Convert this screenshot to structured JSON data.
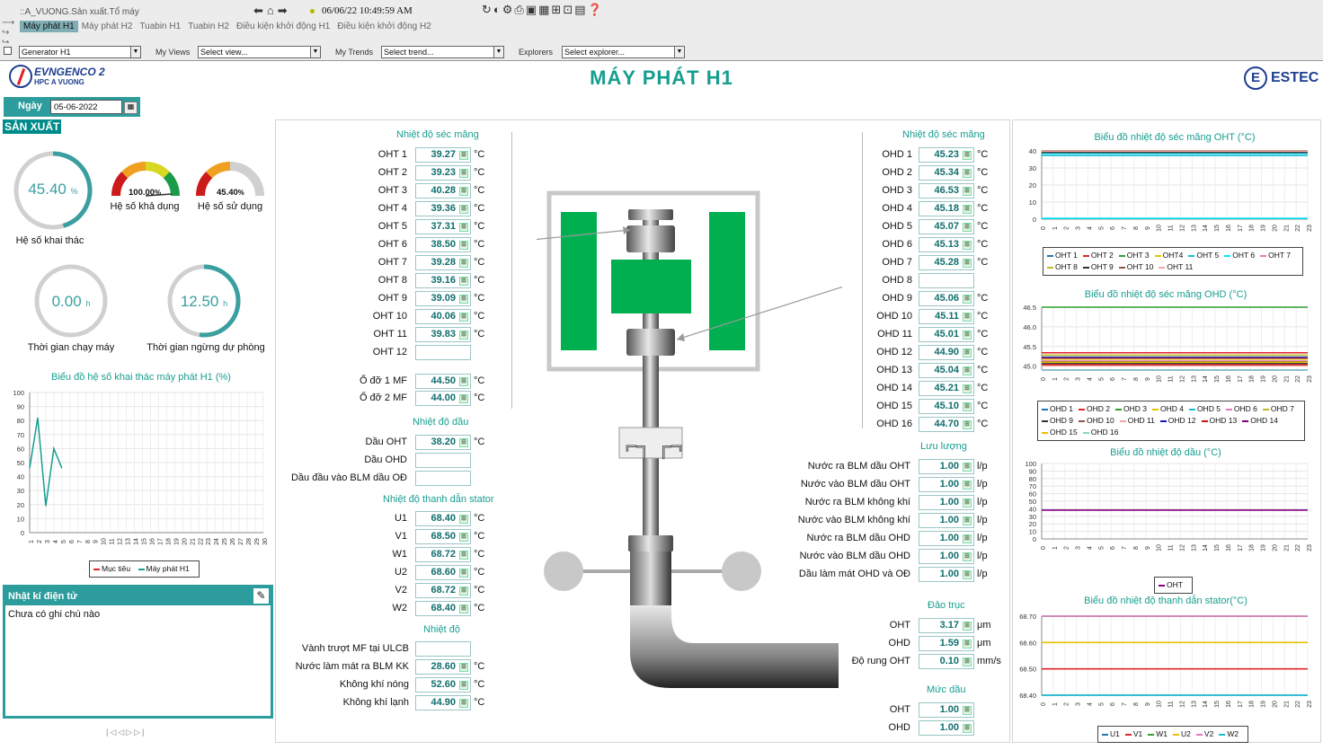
{
  "topbar": {
    "path": "::A_VUONG.Sản xuất.Tổ máy",
    "datetime": "06/06/22 10:49:59 AM",
    "tabs": [
      "Máy phát H1",
      "Máy phát H2",
      "Tuabin H1",
      "Tuabin H2",
      "Điều kiện khởi động H1",
      "Điều kiện khởi động H2"
    ]
  },
  "filters": {
    "generator": "Generator H1",
    "views_label": "My Views",
    "views": "Select view...",
    "trends_label": "My Trends",
    "trends": "Select trend...",
    "explorers_label": "Explorers",
    "explorers": "Select explorer..."
  },
  "header": {
    "logo_line1": "EVNGENCO 2",
    "logo_line2": "HPC A VUONG",
    "title": "MÁY PHÁT H1",
    "estec": "ESTEC"
  },
  "date": {
    "label": "Ngày",
    "value": "05-06-2022"
  },
  "production": {
    "heading": "SẢN XUẤT",
    "khai_thac": {
      "value": "45.40",
      "unit": "%",
      "label": "Hệ số khai thác",
      "fraction": 0.454
    },
    "kha_dung": {
      "value": "100.00",
      "unit": "%",
      "label": "Hệ số khả dụng"
    },
    "su_dung": {
      "value": "45.40",
      "unit": "%",
      "label": "Hệ số sử dụng"
    },
    "chay_may": {
      "value": "0.00",
      "unit": "h",
      "label": "Thời gian chạy máy",
      "fraction": 0
    },
    "ngung": {
      "value": "12.50",
      "unit": "h",
      "label": "Thời gian ngừng dự phòng",
      "fraction": 0.52
    }
  },
  "journal": {
    "title": "Nhật kí điện tử",
    "text": "Chưa có ghi chú nào"
  },
  "oht": {
    "heading": "Nhiệt độ séc măng",
    "rows": [
      {
        "label": "OHT 1",
        "value": "39.27",
        "unit": "°C"
      },
      {
        "label": "OHT 2",
        "value": "39.23",
        "unit": "°C"
      },
      {
        "label": "OHT 3",
        "value": "40.28",
        "unit": "°C"
      },
      {
        "label": "OHT 4",
        "value": "39.36",
        "unit": "°C"
      },
      {
        "label": "OHT 5",
        "value": "37.31",
        "unit": "°C"
      },
      {
        "label": "OHT 6",
        "value": "38.50",
        "unit": "°C"
      },
      {
        "label": "OHT 7",
        "value": "39.28",
        "unit": "°C"
      },
      {
        "label": "OHT 8",
        "value": "39.16",
        "unit": "°C"
      },
      {
        "label": "OHT 9",
        "value": "39.09",
        "unit": "°C"
      },
      {
        "label": "OHT 10",
        "value": "40.06",
        "unit": "°C"
      },
      {
        "label": "OHT 11",
        "value": "39.83",
        "unit": "°C"
      },
      {
        "label": "OHT 12",
        "value": "",
        "unit": ""
      }
    ],
    "bearings": [
      {
        "label": "Ổ đỡ 1 MF",
        "value": "44.50",
        "unit": "°C"
      },
      {
        "label": "Ổ đỡ 2 MF",
        "value": "44.00",
        "unit": "°C"
      }
    ]
  },
  "oil": {
    "heading": "Nhiệt độ dầu",
    "rows": [
      {
        "label": "Dầu OHT",
        "value": "38.20",
        "unit": "°C"
      },
      {
        "label": "Dầu OHD",
        "value": "",
        "unit": ""
      },
      {
        "label": "Dầu đầu vào BLM dầu OĐ",
        "value": "",
        "unit": ""
      }
    ]
  },
  "stator": {
    "heading": "Nhiệt độ thanh dẫn stator",
    "rows": [
      {
        "label": "U1",
        "value": "68.40",
        "unit": "°C"
      },
      {
        "label": "V1",
        "value": "68.50",
        "unit": "°C"
      },
      {
        "label": "W1",
        "value": "68.72",
        "unit": "°C"
      },
      {
        "label": "U2",
        "value": "68.60",
        "unit": "°C"
      },
      {
        "label": "V2",
        "value": "68.72",
        "unit": "°C"
      },
      {
        "label": "W2",
        "value": "68.40",
        "unit": "°C"
      }
    ]
  },
  "temp": {
    "heading": "Nhiệt độ",
    "rows": [
      {
        "label": "Vành trượt MF tại ULCB",
        "value": "",
        "unit": ""
      },
      {
        "label": "Nước làm mát ra BLM KK",
        "value": "28.60",
        "unit": "°C"
      },
      {
        "label": "Không khí nóng",
        "value": "52.60",
        "unit": "°C"
      },
      {
        "label": "Không khí lạnh",
        "value": "44.90",
        "unit": "°C"
      }
    ]
  },
  "ohd": {
    "heading": "Nhiệt độ séc măng",
    "rows": [
      {
        "label": "OHD 1",
        "value": "45.23",
        "unit": "°C"
      },
      {
        "label": "OHD 2",
        "value": "45.34",
        "unit": "°C"
      },
      {
        "label": "OHD 3",
        "value": "46.53",
        "unit": "°C"
      },
      {
        "label": "OHD 4",
        "value": "45.18",
        "unit": "°C"
      },
      {
        "label": "OHD 5",
        "value": "45.07",
        "unit": "°C"
      },
      {
        "label": "OHD 6",
        "value": "45.13",
        "unit": "°C"
      },
      {
        "label": "OHD 7",
        "value": "45.28",
        "unit": "°C"
      },
      {
        "label": "OHD 8",
        "value": "",
        "unit": ""
      },
      {
        "label": "OHD 9",
        "value": "45.06",
        "unit": "°C"
      },
      {
        "label": "OHD 10",
        "value": "45.11",
        "unit": "°C"
      },
      {
        "label": "OHD 11",
        "value": "45.01",
        "unit": "°C"
      },
      {
        "label": "OHD 12",
        "value": "44.90",
        "unit": "°C"
      },
      {
        "label": "OHD 13",
        "value": "45.04",
        "unit": "°C"
      },
      {
        "label": "OHD 14",
        "value": "45.21",
        "unit": "°C"
      },
      {
        "label": "OHD 15",
        "value": "45.10",
        "unit": "°C"
      },
      {
        "label": "OHD 16",
        "value": "44.70",
        "unit": "°C"
      }
    ]
  },
  "flow": {
    "heading": "Lưu lượng",
    "rows": [
      {
        "label": "Nước ra BLM dầu OHT",
        "value": "1.00",
        "unit": "l/p"
      },
      {
        "label": "Nước vào BLM dầu OHT",
        "value": "1.00",
        "unit": "l/p"
      },
      {
        "label": "Nước ra BLM không khí",
        "value": "1.00",
        "unit": "l/p"
      },
      {
        "label": "Nước vào BLM không khí",
        "value": "1.00",
        "unit": "l/p"
      },
      {
        "label": "Nước ra BLM dầu OHD",
        "value": "1.00",
        "unit": "l/p"
      },
      {
        "label": "Nước vào BLM dầu OHD",
        "value": "1.00",
        "unit": "l/p"
      },
      {
        "label": "Dầu làm mát OHD và OĐ",
        "value": "1.00",
        "unit": "l/p"
      }
    ]
  },
  "runout": {
    "heading": "Đảo trục",
    "rows": [
      {
        "label": "OHT",
        "value": "3.17",
        "unit": "μm"
      },
      {
        "label": "OHD",
        "value": "1.59",
        "unit": "μm"
      },
      {
        "label": "Độ rung OHT",
        "value": "0.10",
        "unit": "mm/s"
      }
    ]
  },
  "level": {
    "heading": "Mức dầu",
    "rows": [
      {
        "label": "OHT",
        "value": "1.00",
        "unit": ""
      },
      {
        "label": "OHD",
        "value": "1.00",
        "unit": ""
      }
    ]
  },
  "colors": {
    "accent": "#169e90",
    "green": "#00b050",
    "teal": "#008b8b"
  },
  "chart_data": [
    {
      "id": "khaithac",
      "type": "line",
      "title": "Biểu đồ hệ số khai thác máy phát H1 (%)",
      "x": [
        "1",
        "2",
        "3",
        "4",
        "5",
        "6",
        "7",
        "8",
        "9",
        "10",
        "11",
        "12",
        "13",
        "14",
        "15",
        "16",
        "17",
        "18",
        "19",
        "20",
        "21",
        "22",
        "23",
        "24",
        "25",
        "26",
        "27",
        "28",
        "29",
        "30"
      ],
      "ylim": [
        0,
        100
      ],
      "yticks": [
        0,
        10,
        20,
        30,
        40,
        50,
        60,
        70,
        80,
        90,
        100
      ],
      "series": [
        {
          "name": "Mục tiêu",
          "color": "#e0242a",
          "values": []
        },
        {
          "name": "Máy phát H1",
          "color": "#169e90",
          "values": [
            46,
            82,
            19,
            60,
            46
          ]
        }
      ]
    },
    {
      "id": "oht",
      "type": "line",
      "title": "Biểu đồ nhiệt độ séc măng OHT (°C)",
      "x": [
        "0",
        "1",
        "2",
        "3",
        "4",
        "5",
        "6",
        "7",
        "8",
        "9",
        "10",
        "11",
        "12",
        "13",
        "14",
        "15",
        "16",
        "17",
        "18",
        "19",
        "20",
        "21",
        "22",
        "23"
      ],
      "ylim": [
        0,
        40
      ],
      "yticks": [
        0,
        10,
        20,
        30,
        40
      ],
      "series": [
        {
          "name": "OHT 1",
          "color": "#1f77b4",
          "value": 39.27
        },
        {
          "name": "OHT 2",
          "color": "#e0242a",
          "value": 39.23
        },
        {
          "name": "OHT 3",
          "color": "#2ca02c",
          "value": 40.28
        },
        {
          "name": "OHT4",
          "color": "#e8c000",
          "value": 39.36
        },
        {
          "name": "OHT 5",
          "color": "#17becf",
          "value": 37.31
        },
        {
          "name": "OHT 6",
          "color": "#00e5ff",
          "value": 38.5
        },
        {
          "name": "OHT 7",
          "color": "#e377c2",
          "value": 39.28
        },
        {
          "name": "OHT 8",
          "color": "#bcbd22",
          "value": 39.16
        },
        {
          "name": "OHT 9",
          "color": "#333333",
          "value": 39.09
        },
        {
          "name": "OHT 10",
          "color": "#8c564b",
          "value": 40.06
        },
        {
          "name": "OHT 11",
          "color": "#f4a6a6",
          "value": 39.83
        },
        {
          "name": "",
          "color": "#00e5ff",
          "value": 0.5
        }
      ]
    },
    {
      "id": "ohd",
      "type": "line",
      "title": "Biểu đồ nhiệt độ séc măng OHD (°C)",
      "x": [
        "0",
        "1",
        "2",
        "3",
        "4",
        "5",
        "6",
        "7",
        "8",
        "9",
        "10",
        "11",
        "12",
        "13",
        "14",
        "15",
        "16",
        "17",
        "18",
        "19",
        "20",
        "21",
        "22",
        "23"
      ],
      "ylim": [
        44.9,
        46.5
      ],
      "yticks": [
        45.0,
        45.5,
        46.0,
        46.5
      ],
      "series": [
        {
          "name": "OHD 1",
          "color": "#1f77b4",
          "value": 45.23
        },
        {
          "name": "OHD 2",
          "color": "#e0242a",
          "value": 45.34
        },
        {
          "name": "OHD 3",
          "color": "#2ca02c",
          "value": 46.53
        },
        {
          "name": "OHD 4",
          "color": "#e8c000",
          "value": 45.18
        },
        {
          "name": "OHD 5",
          "color": "#17becf",
          "value": 45.07
        },
        {
          "name": "OHD 6",
          "color": "#e377c2",
          "value": 45.13
        },
        {
          "name": "OHD 7",
          "color": "#bcbd22",
          "value": 45.28
        },
        {
          "name": "OHD 9",
          "color": "#333333",
          "value": 45.06
        },
        {
          "name": "OHD 10",
          "color": "#8c564b",
          "value": 45.11
        },
        {
          "name": "OHD 11",
          "color": "#f4a6a6",
          "value": 45.01
        },
        {
          "name": "OHD 12",
          "color": "#1515d0",
          "value": 44.9
        },
        {
          "name": "OHD 13",
          "color": "#d01515",
          "value": 45.04
        },
        {
          "name": "OHD 14",
          "color": "#800080",
          "value": 45.21
        },
        {
          "name": "OHD 15",
          "color": "#e8c000",
          "value": 45.1
        },
        {
          "name": "OHD 16",
          "color": "#8dd3c7",
          "value": 44.7
        }
      ]
    },
    {
      "id": "dau",
      "type": "line",
      "title": "Biểu đồ nhiệt độ dầu (°C)",
      "x": [
        "0",
        "1",
        "2",
        "3",
        "4",
        "5",
        "6",
        "7",
        "8",
        "9",
        "10",
        "11",
        "12",
        "13",
        "14",
        "15",
        "16",
        "17",
        "18",
        "19",
        "20",
        "21",
        "22",
        "23"
      ],
      "ylim": [
        0,
        100
      ],
      "yticks": [
        0,
        10,
        20,
        30,
        40,
        50,
        60,
        70,
        80,
        90,
        100
      ],
      "series": [
        {
          "name": "OHT",
          "color": "#800080",
          "value": 38.2
        }
      ]
    },
    {
      "id": "stator",
      "type": "line",
      "title": "Biểu đồ nhiệt độ thanh dẫn stator(°C)",
      "x": [
        "0",
        "1",
        "2",
        "3",
        "4",
        "5",
        "6",
        "7",
        "8",
        "9",
        "10",
        "11",
        "12",
        "13",
        "14",
        "15",
        "16",
        "17",
        "18",
        "19",
        "20",
        "21",
        "22",
        "23"
      ],
      "ylim": [
        68.4,
        68.7
      ],
      "yticks": [
        68.4,
        68.5,
        68.6,
        68.7
      ],
      "series": [
        {
          "name": "U1",
          "color": "#1f77b4",
          "value": 68.4
        },
        {
          "name": "V1",
          "color": "#e0242a",
          "value": 68.5
        },
        {
          "name": "W1",
          "color": "#2ca02c",
          "value": 68.72
        },
        {
          "name": "U2",
          "color": "#e8c000",
          "value": 68.6
        },
        {
          "name": "V2",
          "color": "#e377c2",
          "value": 68.72
        },
        {
          "name": "W2",
          "color": "#17becf",
          "value": 68.4
        }
      ]
    }
  ]
}
